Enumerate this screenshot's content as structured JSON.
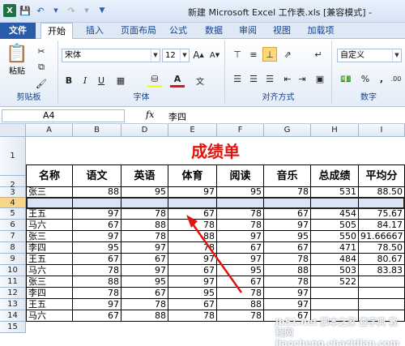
{
  "window": {
    "title": "新建 Microsoft Excel 工作表.xls  [兼容模式] -"
  },
  "ribbon_tabs": [
    "文件",
    "开始",
    "插入",
    "页面布局",
    "公式",
    "数据",
    "审阅",
    "视图",
    "加载项"
  ],
  "ribbon": {
    "clipboard_label": "剪贴板",
    "paste_label": "粘贴",
    "font_label": "字体",
    "font_name": "宋体",
    "font_size": "12",
    "bold": "B",
    "italic": "I",
    "underline": "U",
    "font_color_letter": "A",
    "grow_font": "A",
    "shrink_font": "A",
    "align_label": "对齐方式",
    "number_label": "数字",
    "number_format": "自定义",
    "percent": "%",
    "comma": ","
  },
  "formula_bar": {
    "name_box": "A4",
    "fx": "fx",
    "content": "李四"
  },
  "columns": [
    "A",
    "B",
    "D",
    "E",
    "F",
    "G",
    "H",
    "I"
  ],
  "row_numbers": [
    "1",
    "2",
    "3",
    "4",
    "5",
    "6",
    "7",
    "8",
    "9",
    "10",
    "11",
    "12",
    "13",
    "14",
    "15"
  ],
  "sheet": {
    "title": "成绩单",
    "headers": [
      "名称",
      "语文",
      "英语",
      "体育",
      "阅读",
      "音乐",
      "总成绩",
      "平均分"
    ],
    "rows": [
      [
        "张三",
        "88",
        "95",
        "97",
        "95",
        "78",
        "531",
        "88.50"
      ],
      [
        "",
        "",
        "",
        "",
        "",
        "",
        "",
        ""
      ],
      [
        "王五",
        "97",
        "78",
        "67",
        "78",
        "67",
        "454",
        "75.67"
      ],
      [
        "马六",
        "67",
        "88",
        "78",
        "78",
        "97",
        "505",
        "84.17"
      ],
      [
        "张三",
        "97",
        "78",
        "88",
        "97",
        "95",
        "550",
        "91.66667"
      ],
      [
        "李四",
        "95",
        "97",
        "78",
        "67",
        "67",
        "471",
        "78.50"
      ],
      [
        "王五",
        "67",
        "67",
        "97",
        "97",
        "78",
        "484",
        "80.67"
      ],
      [
        "马六",
        "78",
        "97",
        "67",
        "95",
        "88",
        "503",
        "83.83"
      ],
      [
        "张三",
        "88",
        "95",
        "97",
        "67",
        "78",
        "522",
        ""
      ],
      [
        "李四",
        "78",
        "67",
        "95",
        "78",
        "97",
        "",
        ""
      ],
      [
        "王五",
        "97",
        "78",
        "67",
        "88",
        "97",
        "",
        ""
      ],
      [
        "马六",
        "67",
        "88",
        "78",
        "78",
        "67",
        "",
        ""
      ]
    ]
  },
  "watermark": "jb51.net  脚本之家  查字典 教程网  jiaocheng.chazidian.com"
}
